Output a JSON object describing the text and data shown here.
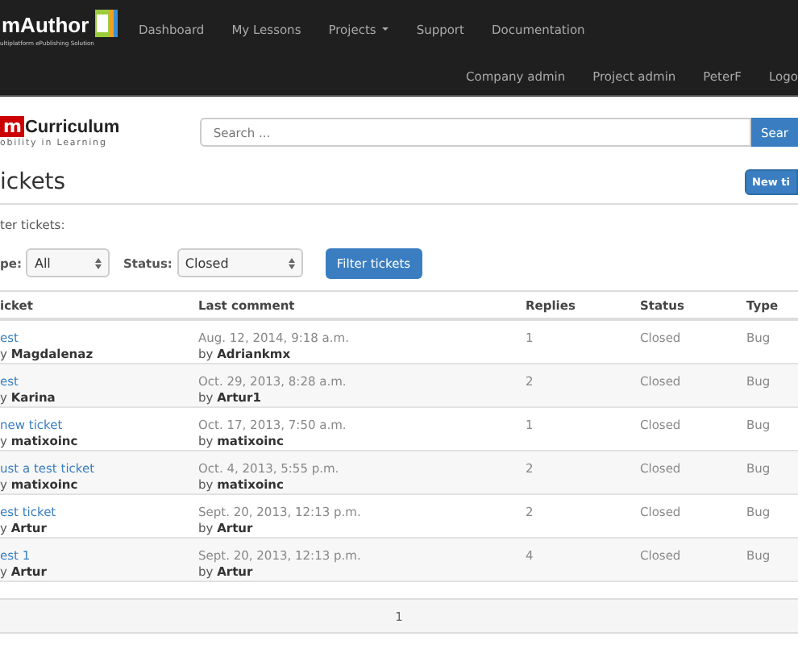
{
  "navbar": {
    "brand": "mAuthor",
    "tagline": "ultiplatform ePublishing Solution",
    "items": [
      {
        "label": "Dashboard",
        "dropdown": false
      },
      {
        "label": "My Lessons",
        "dropdown": false
      },
      {
        "label": "Projects",
        "dropdown": true
      },
      {
        "label": "Support",
        "dropdown": false
      },
      {
        "label": "Documentation",
        "dropdown": false
      }
    ],
    "user_items": [
      "Company admin",
      "Project admin",
      "PeterF",
      "Logo"
    ]
  },
  "header": {
    "logo_mark": "m",
    "logo_name": "Curriculum",
    "logo_tagline": "obility in Learning",
    "search": {
      "placeholder": "Search ..."
    },
    "search_button": "Sear"
  },
  "page": {
    "title": "ickets",
    "new_button": "New ti"
  },
  "filters": {
    "label": "ter tickets:",
    "type_label": "pe:",
    "type_value": "All",
    "status_label": "Status:",
    "status_value": "Closed",
    "button": "Filter tickets"
  },
  "table": {
    "columns": [
      "icket",
      "Last comment",
      "Replies",
      "Status",
      "Type"
    ],
    "rows": [
      {
        "title": "est",
        "author": "y **Magdalenaz**",
        "date": "Aug. 12, 2014, 9:18 a.m.",
        "commenter": "by **Adriankmx**",
        "replies": "1",
        "status": "Closed",
        "type": "Bug"
      },
      {
        "title": "est",
        "author": "y **Karina**",
        "date": "Oct. 29, 2013, 8:28 a.m.",
        "commenter": "by **Artur1**",
        "replies": "2",
        "status": "Closed",
        "type": "Bug"
      },
      {
        "title": "new ticket",
        "author": "y **matixoinc**",
        "date": "Oct. 17, 2013, 7:50 a.m.",
        "commenter": "by **matixoinc**",
        "replies": "1",
        "status": "Closed",
        "type": "Bug"
      },
      {
        "title": "ust a test ticket",
        "author": "y **matixoinc**",
        "date": "Oct. 4, 2013, 5:55 p.m.",
        "commenter": "by **matixoinc**",
        "replies": "2",
        "status": "Closed",
        "type": "Bug"
      },
      {
        "title": "est ticket",
        "author": "y **Artur**",
        "date": "Sept. 20, 2013, 12:13 p.m.",
        "commenter": "by **Artur**",
        "replies": "2",
        "status": "Closed",
        "type": "Bug"
      },
      {
        "title": "est 1",
        "author": "y **Artur**",
        "date": "Sept. 20, 2013, 12:13 p.m.",
        "commenter": "by **Artur**",
        "replies": "4",
        "status": "Closed",
        "type": "Bug"
      }
    ]
  },
  "pagination": {
    "pages": [
      {
        "label": "1",
        "selected": true
      }
    ]
  }
}
